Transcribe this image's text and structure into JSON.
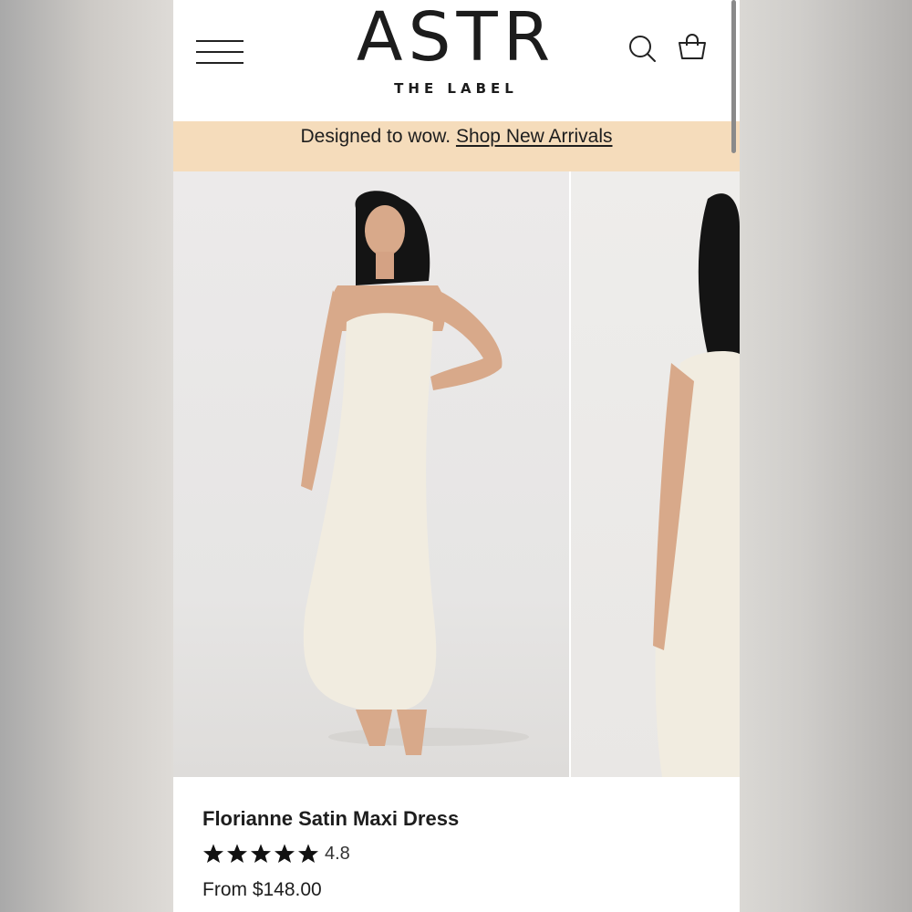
{
  "header": {
    "logo_main": "ASTR",
    "logo_sub": "THE LABEL",
    "menu_icon": "hamburger-menu-icon",
    "search_icon": "search-icon",
    "cart_icon": "shopping-bag-icon"
  },
  "promo": {
    "text": "Designed to wow.",
    "link": "Shop New Arrivals",
    "background": "#f5dcbb"
  },
  "product": {
    "name": "Florianne Satin Maxi Dress",
    "rating": "4.8",
    "stars": 5,
    "price": "From $148.00",
    "dress_color": "#f1ece0"
  }
}
